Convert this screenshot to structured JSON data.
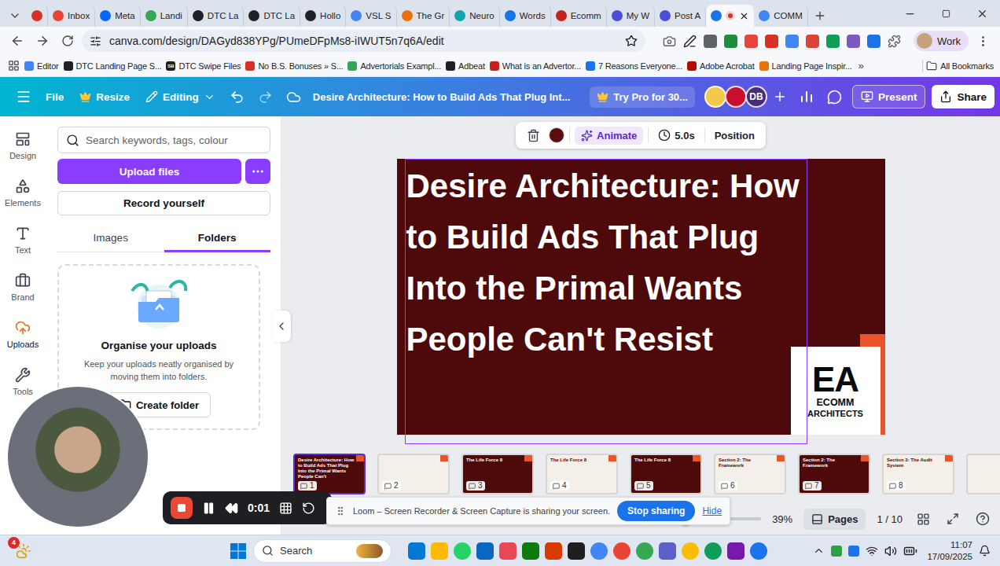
{
  "browser": {
    "tabs": [
      {
        "label": "",
        "selected": false,
        "recording": false,
        "color": "#d93025"
      },
      {
        "label": "Inbox",
        "selected": false,
        "recording": false,
        "color": "#ea4335"
      },
      {
        "label": "Meta",
        "selected": false,
        "recording": false,
        "color": "#0866ff"
      },
      {
        "label": "Landi",
        "selected": false,
        "recording": false,
        "color": "#34a853"
      },
      {
        "label": "DTC La",
        "selected": false,
        "recording": false,
        "color": "#202124"
      },
      {
        "label": "DTC La",
        "selected": false,
        "recording": false,
        "color": "#202124"
      },
      {
        "label": "Hollo",
        "selected": false,
        "recording": false,
        "color": "#202124"
      },
      {
        "label": "VSL S",
        "selected": false,
        "recording": false,
        "color": "#4285f4"
      },
      {
        "label": "The Gr",
        "selected": false,
        "recording": false,
        "color": "#e8710a"
      },
      {
        "label": "Neuro",
        "selected": false,
        "recording": false,
        "color": "#12a4af"
      },
      {
        "label": "Words",
        "selected": false,
        "recording": false,
        "color": "#1a73e8"
      },
      {
        "label": "Ecomm",
        "selected": false,
        "recording": false,
        "color": "#c5221f"
      },
      {
        "label": "My W",
        "selected": false,
        "recording": false,
        "color": "#4b4fd8"
      },
      {
        "label": "Post A",
        "selected": false,
        "recording": false,
        "color": "#4b4fd8"
      },
      {
        "label": "",
        "selected": true,
        "recording": true,
        "color": "#1a73e8"
      },
      {
        "label": "COMM",
        "selected": false,
        "recording": false,
        "color": "#4285f4"
      }
    ],
    "url": "canva.com/design/DAGyd838YPg/PUmeDFpMs8-iIWUT5n7q6A/edit",
    "profile": "Work",
    "bookmarks": [
      {
        "label": "Editor",
        "color": "#4285f4",
        "icon_text": ""
      },
      {
        "label": "DTC Landing Page S...",
        "color": "#202124",
        "icon_text": ""
      },
      {
        "label": "DTC Swipe Files",
        "color": "#202124",
        "icon_text": "SB"
      },
      {
        "label": "No B.S. Bonuses » S...",
        "color": "#d93025",
        "icon_text": ""
      },
      {
        "label": "Advertorials Exampl...",
        "color": "#34a853",
        "icon_text": ""
      },
      {
        "label": "Adbeat",
        "color": "#202124",
        "icon_text": ""
      },
      {
        "label": "What is an Advertor...",
        "color": "#c5221f",
        "icon_text": ""
      },
      {
        "label": "7 Reasons Everyone...",
        "color": "#1a73e8",
        "icon_text": ""
      },
      {
        "label": "Adobe Acrobat",
        "color": "#b30b00",
        "icon_text": ""
      },
      {
        "label": "Landing Page Inspir...",
        "color": "#e8710a",
        "icon_text": ""
      }
    ],
    "more_bookmarks": "»",
    "all_bookmarks": "All Bookmarks"
  },
  "canva_header": {
    "file": "File",
    "resize": "Resize",
    "mode": "Editing",
    "title": "Desire Architecture: How to Build Ads That Plug Int...",
    "try_pro": "Try Pro for 30...",
    "collaborators": [
      {
        "initials": "",
        "color": "#f2c94c"
      },
      {
        "initials": "",
        "color": "#c8102e"
      },
      {
        "initials": "DB",
        "color": "#4a2a7a"
      }
    ],
    "present": "Present",
    "share": "Share"
  },
  "side_rail": [
    {
      "label": "Design",
      "selected": false
    },
    {
      "label": "Elements",
      "selected": false
    },
    {
      "label": "Text",
      "selected": false
    },
    {
      "label": "Brand",
      "selected": false
    },
    {
      "label": "Uploads",
      "selected": true
    },
    {
      "label": "Tools",
      "selected": false
    }
  ],
  "uploads_panel": {
    "search_placeholder": "Search keywords, tags, colour",
    "upload_button": "Upload files",
    "record_button": "Record yourself",
    "tabs": [
      {
        "label": "Images",
        "selected": false
      },
      {
        "label": "Folders",
        "selected": true
      }
    ],
    "empty_title": "Organise your uploads",
    "empty_text": "Keep your uploads neatly organised by moving them into folders.",
    "create_folder": "Create folder"
  },
  "element_toolbar": {
    "color": "#5a0f0f",
    "animate": "Animate",
    "duration": "5.0s",
    "position": "Position"
  },
  "slide": {
    "color": "#4e0a0a",
    "title": "Desire Architecture: How to Build Ads That Plug Into the Primal Wants People Can't Resist",
    "title_selected": true,
    "logo_mark": "EA",
    "logo_line1": "ECOMM",
    "logo_line2": "ARCHITECTS"
  },
  "pages": [
    {
      "number": "1",
      "title": "Desire Architecture: How to Build Ads That Plug Into the Primal Wants People Can't",
      "kind": "dark",
      "selected": true
    },
    {
      "number": "2",
      "title": "",
      "kind": "light",
      "selected": false
    },
    {
      "number": "3",
      "title": "The Life Force 8",
      "kind": "dark",
      "selected": false
    },
    {
      "number": "4",
      "title": "The Life Force 8",
      "kind": "light",
      "selected": false
    },
    {
      "number": "5",
      "title": "The Life Force 8",
      "kind": "dark",
      "selected": false
    },
    {
      "number": "6",
      "title": "Section 2: The Framework",
      "kind": "light",
      "selected": false
    },
    {
      "number": "7",
      "title": "Section 2: The Framework",
      "kind": "dark",
      "selected": false
    },
    {
      "number": "8",
      "title": "Section 3: The Audit System",
      "kind": "light",
      "selected": false
    },
    {
      "number": "",
      "title": "",
      "kind": "light",
      "selected": false
    }
  ],
  "status_bar": {
    "zoom_level": 0.02,
    "zoom": "39%",
    "pages_button": "Pages",
    "page_count": "1 / 10"
  },
  "loom": {
    "recording": true,
    "timer": "0:01",
    "share_text": "Loom – Screen Recorder & Screen Capture is sharing your screen.",
    "stop_sharing": "Stop sharing",
    "hide": "Hide"
  },
  "taskbar": {
    "notifications": "4",
    "search": "Search",
    "time": "11:07",
    "date": "17/09/2025"
  }
}
